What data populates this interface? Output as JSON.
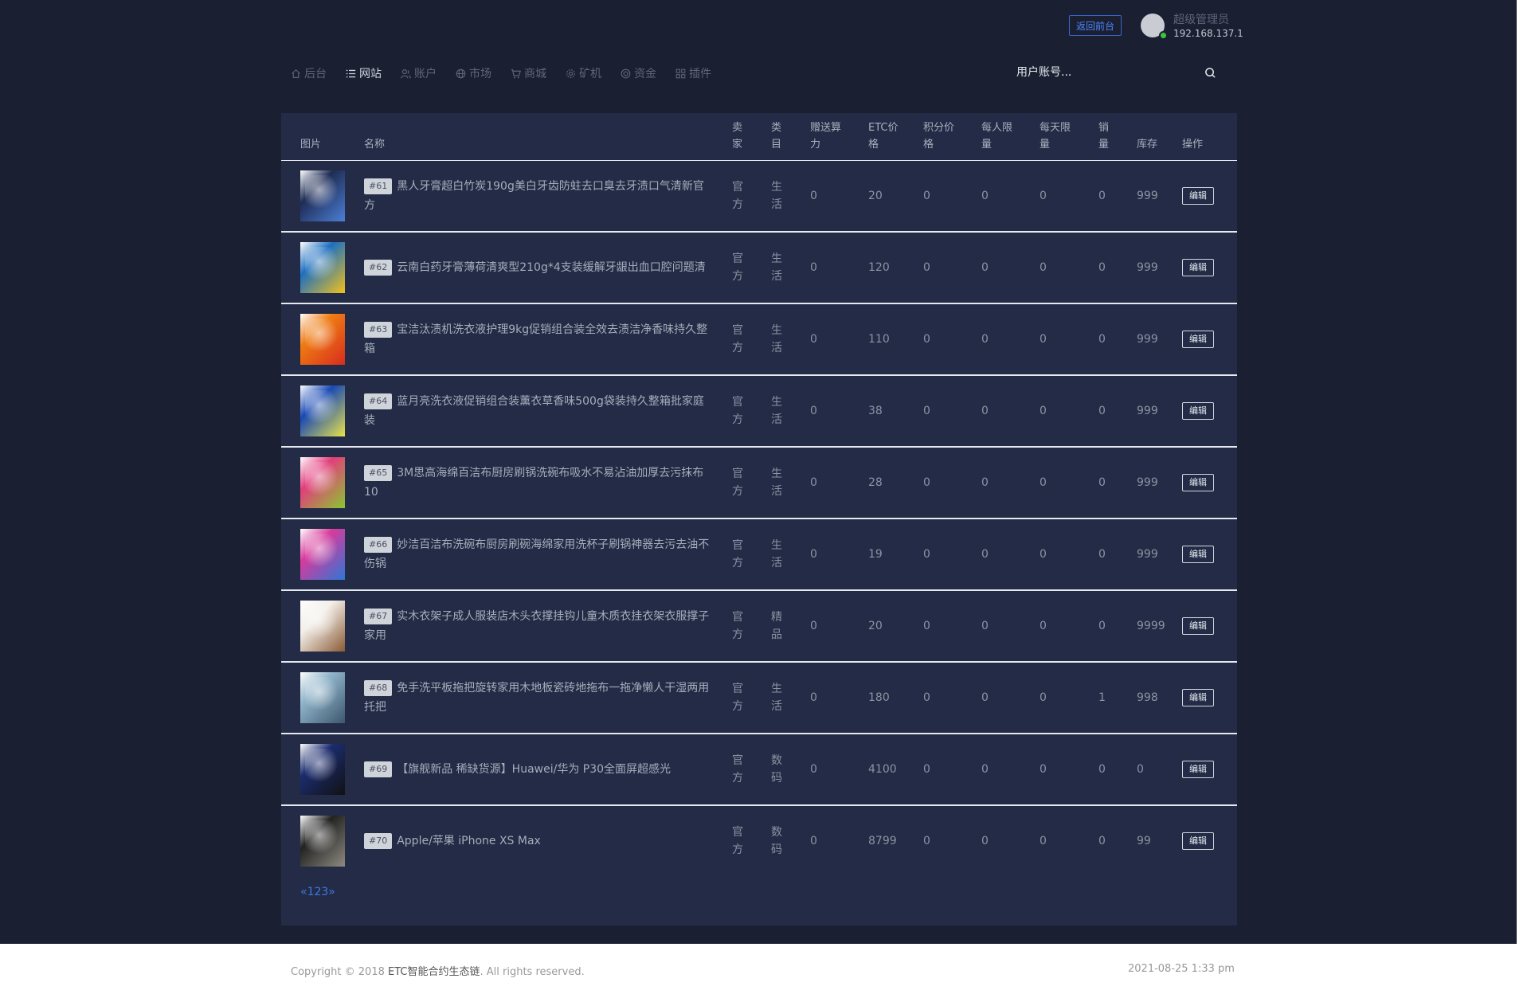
{
  "header": {
    "back_button": "返回前台",
    "user_name": "超级管理员",
    "user_ip": "192.168.137.1"
  },
  "nav": [
    {
      "label": "后台",
      "icon": "home-icon"
    },
    {
      "label": "网站",
      "icon": "list-icon",
      "active": true
    },
    {
      "label": "账户",
      "icon": "users-icon"
    },
    {
      "label": "市场",
      "icon": "globe-icon"
    },
    {
      "label": "商城",
      "icon": "cart-icon"
    },
    {
      "label": "矿机",
      "icon": "gear-icon"
    },
    {
      "label": "资金",
      "icon": "coin-icon"
    },
    {
      "label": "插件",
      "icon": "grid-icon"
    }
  ],
  "search": {
    "placeholder": "用户账号..."
  },
  "table": {
    "headers": {
      "pic": "图片",
      "name": "名称",
      "seller": "卖家",
      "category": "类目",
      "gift_power": "赠送算力",
      "etc_price": "ETC价格",
      "points_price": "积分价格",
      "per_user_limit": "每人限量",
      "per_day_limit": "每天限量",
      "sales": "销量",
      "stock": "库存",
      "action": "操作"
    },
    "rows": [
      {
        "id": "#61",
        "name": "黑人牙膏超白竹炭190g美白牙齿防蛀去口臭去牙渍口气清新官方",
        "seller": "官方",
        "category": "生活",
        "gift_power": "0",
        "etc_price": "20",
        "points_price": "0",
        "per_user_limit": "0",
        "per_day_limit": "0",
        "sales": "0",
        "stock": "999",
        "action": "编辑",
        "thumb": "toothpaste-black"
      },
      {
        "id": "#62",
        "name": "云南白药牙膏薄荷清爽型210g*4支装缓解牙龈出血口腔问题清",
        "seller": "官方",
        "category": "生活",
        "gift_power": "0",
        "etc_price": "120",
        "points_price": "0",
        "per_user_limit": "0",
        "per_day_limit": "0",
        "sales": "0",
        "stock": "999",
        "action": "编辑",
        "thumb": "toothpaste-box"
      },
      {
        "id": "#63",
        "name": "宝洁汰渍机洗衣液护理9kg促销组合装全效去渍洁净香味持久整箱",
        "seller": "官方",
        "category": "生活",
        "gift_power": "0",
        "etc_price": "110",
        "points_price": "0",
        "per_user_limit": "0",
        "per_day_limit": "0",
        "sales": "0",
        "stock": "999",
        "action": "编辑",
        "thumb": "detergent-orange"
      },
      {
        "id": "#64",
        "name": "蓝月亮洗衣液促销组合装薰衣草香味500g袋装持久整箱批家庭装",
        "seller": "官方",
        "category": "生活",
        "gift_power": "0",
        "etc_price": "38",
        "points_price": "0",
        "per_user_limit": "0",
        "per_day_limit": "0",
        "sales": "0",
        "stock": "999",
        "action": "编辑",
        "thumb": "detergent-blue"
      },
      {
        "id": "#65",
        "name": "3M思高海绵百洁布厨房刷锅洗碗布吸水不易沾油加厚去污抹布10",
        "seller": "官方",
        "category": "生活",
        "gift_power": "0",
        "etc_price": "28",
        "points_price": "0",
        "per_user_limit": "0",
        "per_day_limit": "0",
        "sales": "0",
        "stock": "999",
        "action": "编辑",
        "thumb": "sponge"
      },
      {
        "id": "#66",
        "name": "妙洁百洁布洗碗布厨房刷碗海绵家用洗杯子刷锅神器去污去油不伤锅",
        "seller": "官方",
        "category": "生活",
        "gift_power": "0",
        "etc_price": "19",
        "points_price": "0",
        "per_user_limit": "0",
        "per_day_limit": "0",
        "sales": "0",
        "stock": "999",
        "action": "编辑",
        "thumb": "scrub-pad"
      },
      {
        "id": "#67",
        "name": "实木衣架子成人服装店木头衣撑挂钩儿童木质衣挂衣架衣服撑子家用",
        "seller": "官方",
        "category": "精品",
        "gift_power": "0",
        "etc_price": "20",
        "points_price": "0",
        "per_user_limit": "0",
        "per_day_limit": "0",
        "sales": "0",
        "stock": "9999",
        "action": "编辑",
        "thumb": "hanger"
      },
      {
        "id": "#68",
        "name": "免手洗平板拖把旋转家用木地板瓷砖地拖布一拖净懒人干湿两用托把",
        "seller": "官方",
        "category": "生活",
        "gift_power": "0",
        "etc_price": "180",
        "points_price": "0",
        "per_user_limit": "0",
        "per_day_limit": "0",
        "sales": "1",
        "stock": "998",
        "action": "编辑",
        "thumb": "mop"
      },
      {
        "id": "#69",
        "name": "【旗舰新品 稀缺货源】Huawei/华为 P30全面屏超感光",
        "seller": "官方",
        "category": "数码",
        "gift_power": "0",
        "etc_price": "4100",
        "points_price": "0",
        "per_user_limit": "0",
        "per_day_limit": "0",
        "sales": "0",
        "stock": "0",
        "action": "编辑",
        "thumb": "phone-huawei"
      },
      {
        "id": "#70",
        "name": "Apple/苹果 iPhone XS Max",
        "seller": "官方",
        "category": "数码",
        "gift_power": "0",
        "etc_price": "8799",
        "points_price": "0",
        "per_user_limit": "0",
        "per_day_limit": "0",
        "sales": "0",
        "stock": "99",
        "action": "编辑",
        "thumb": "phone-iphone"
      }
    ]
  },
  "pagination": "«123»",
  "footer": {
    "copyright_prefix": "Copyright © 2018 ",
    "brand": "ETC智能合约生态链",
    "copyright_suffix": ". All rights reserved.",
    "datetime": "2021-08-25 1:33 pm"
  }
}
